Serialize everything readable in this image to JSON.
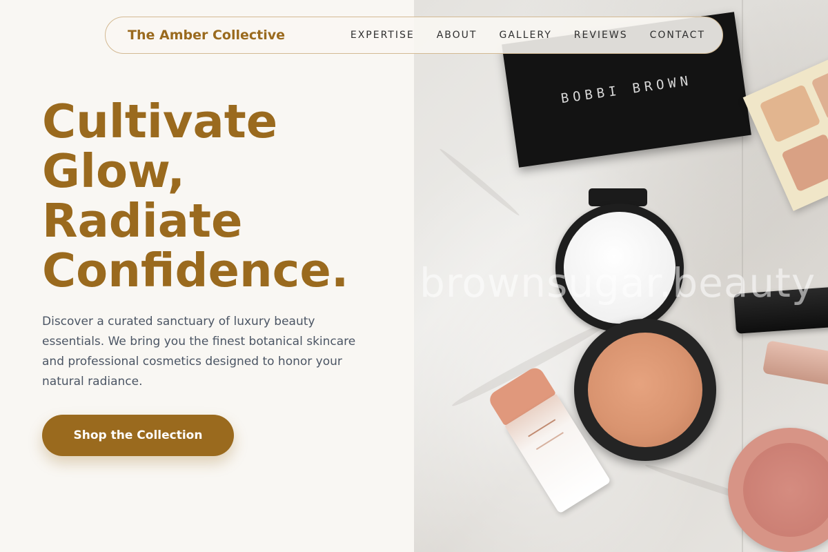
{
  "brand": {
    "name": "The Amber Collective",
    "accent_color": "#9a6a1e"
  },
  "nav": {
    "items": [
      {
        "label": "EXPERTISE"
      },
      {
        "label": "ABOUT"
      },
      {
        "label": "GALLERY"
      },
      {
        "label": "REVIEWS"
      },
      {
        "label": "CONTACT"
      }
    ]
  },
  "hero": {
    "headline_lines": [
      "Cultivate",
      "Glow,",
      "Radiate",
      "Confidence."
    ],
    "description": "Discover a curated sanctuary of luxury beauty essentials. We bring you the finest botanical skincare and professional cosmetics designed to honor your natural radiance.",
    "cta_label": "Shop the Collection"
  },
  "image": {
    "palette_brand_text": "BOBBI BROWN",
    "watermark": "brownsugar.beauty"
  }
}
